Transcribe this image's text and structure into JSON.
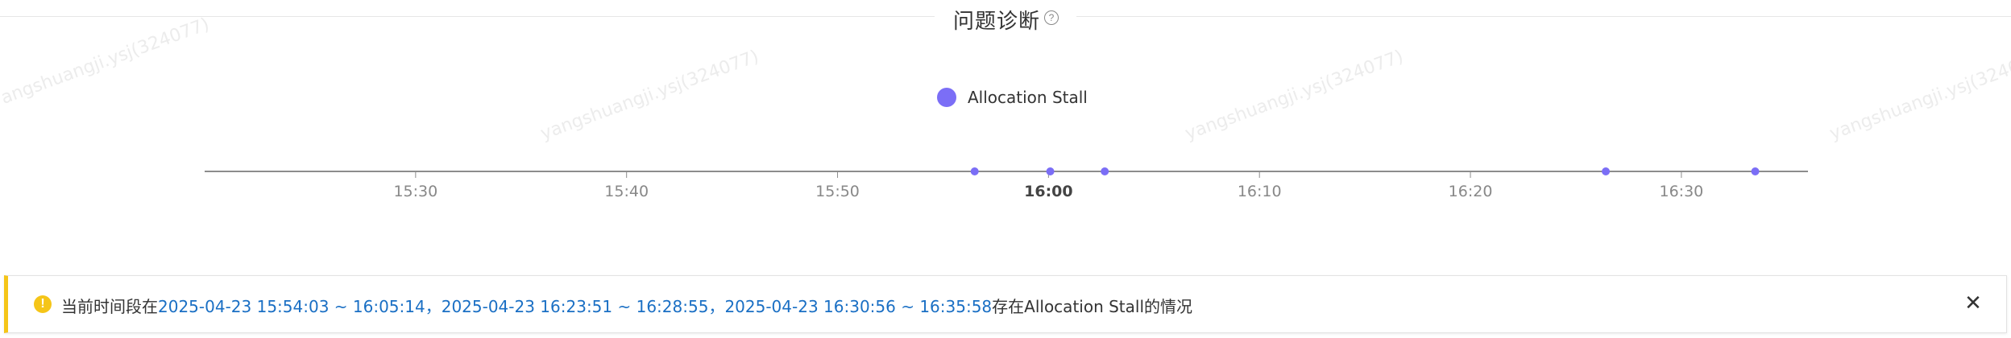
{
  "section": {
    "title": "问题诊断",
    "help_icon": "question-circle-icon"
  },
  "watermark": "yangshuangji.ysj(324077)",
  "chart_data": {
    "type": "scatter",
    "legend": [
      {
        "name": "Allocation Stall",
        "color": "#7b6ef6"
      }
    ],
    "x_ticks": [
      "15:30",
      "15:40",
      "15:50",
      "16:00",
      "16:10",
      "16:20",
      "16:30"
    ],
    "x_bold_tick": "16:00",
    "xlim": [
      "15:20:00",
      "16:36:00"
    ],
    "series": [
      {
        "name": "Allocation Stall",
        "color": "#7b6ef6",
        "points": [
          "15:56:30",
          "16:00:05",
          "16:02:40",
          "16:26:25",
          "16:33:30"
        ]
      }
    ]
  },
  "alert": {
    "icon": "warning-circle-icon",
    "prefix": "当前时间段在",
    "ranges": [
      "2025-04-23 15:54:03 ~ 16:05:14",
      "2025-04-23 16:23:51 ~ 16:28:55",
      "2025-04-23 16:30:56 ~ 16:35:58"
    ],
    "separator": "，",
    "suffix": "存在Allocation Stall的情况",
    "close_icon": "close-icon"
  }
}
